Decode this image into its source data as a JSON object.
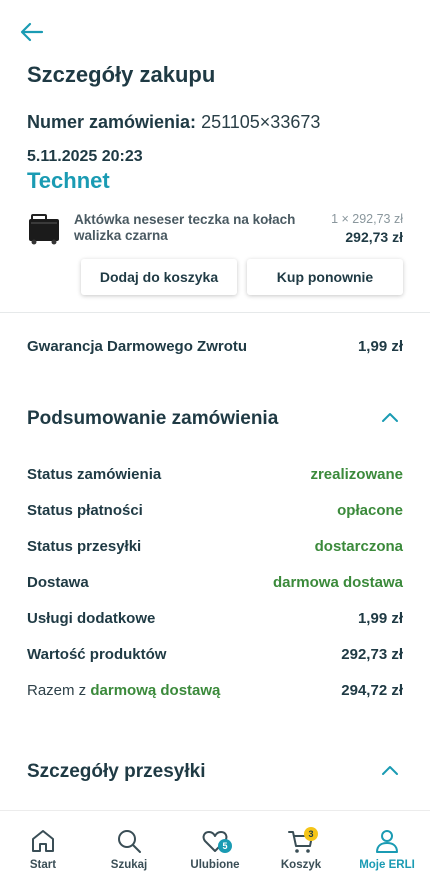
{
  "header": {
    "back_icon": "arrow-left-icon",
    "title": "Szczegóły zakupu"
  },
  "order": {
    "number_label": "Numer zamówienia:",
    "number_value": "251105×33673",
    "date": "5.11.2025 20:23",
    "seller": "Technet"
  },
  "product": {
    "name": "Aktówka neseser teczka na kołach walizka czarna",
    "quantity_price": "1 × 292,73 zł",
    "total": "292,73 zł"
  },
  "actions": {
    "add_to_cart": "Dodaj do koszyka",
    "buy_again": "Kup ponownie"
  },
  "guarantee": {
    "label": "Gwarancja Darmowego Zwrotu",
    "value": "1,99 zł"
  },
  "summary": {
    "title": "Podsumowanie zamówienia",
    "rows": [
      {
        "label": "Status zamówienia",
        "value": "zrealizowane"
      },
      {
        "label": "Status płatności",
        "value": "opłacone"
      },
      {
        "label": "Status przesyłki",
        "value": "dostarczona"
      },
      {
        "label": "Dostawa",
        "value": "darmowa dostawa"
      },
      {
        "label": "Usługi dodatkowe",
        "value": "1,99 zł"
      },
      {
        "label": "Wartość produktów",
        "value": "292,73 zł"
      }
    ],
    "total_prefix": "Razem z",
    "total_highlight": "darmową dostawą",
    "total_value": "294,72 zł"
  },
  "shipping": {
    "title": "Szczegóły przesyłki"
  },
  "nav": {
    "items": [
      {
        "label": "Start",
        "icon": "home-icon"
      },
      {
        "label": "Szukaj",
        "icon": "search-icon"
      },
      {
        "label": "Ulubione",
        "icon": "heart-icon",
        "badge": "5"
      },
      {
        "label": "Koszyk",
        "icon": "cart-icon",
        "badge": "3"
      },
      {
        "label": "Moje ERLI",
        "icon": "user-icon"
      }
    ]
  },
  "colors": {
    "accent": "#1a9bb3",
    "green": "#3b8a3b",
    "text": "#1f3a44",
    "badge_yellow": "#f5c518"
  }
}
